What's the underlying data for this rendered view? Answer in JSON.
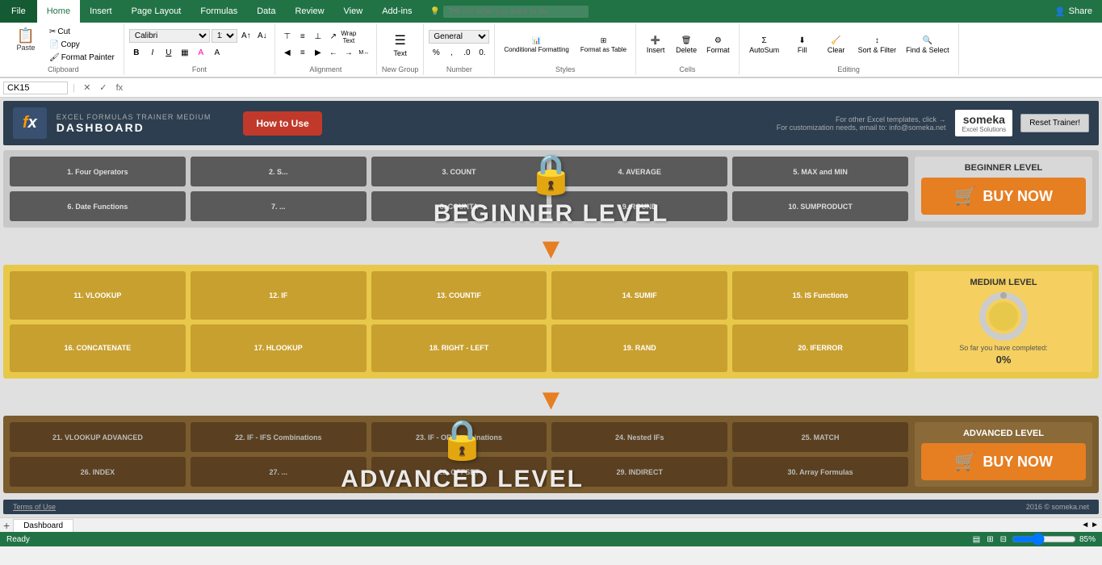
{
  "ribbon": {
    "tabs": [
      "File",
      "Home",
      "Insert",
      "Page Layout",
      "Formulas",
      "Data",
      "Review",
      "View",
      "Add-ins"
    ],
    "active_tab": "Home",
    "tell_me": "Tell me what you want to do",
    "share": "Share",
    "clipboard_group": "Clipboard",
    "paste_label": "Paste",
    "cut_label": "Cut",
    "copy_label": "Copy",
    "format_painter_label": "Format Painter",
    "font_group": "Font",
    "font_name": "Calibri",
    "font_size": "11",
    "alignment_group": "Alignment",
    "wrap_text": "Wrap Text",
    "merge_center": "Merge & Center",
    "number_group": "Number",
    "styles_group": "Styles",
    "conditional_formatting": "Conditional Formatting",
    "format_as_table": "Format as Table",
    "cells_group": "Cells",
    "insert_label": "Insert",
    "delete_label": "Delete",
    "format_label": "Format",
    "editing_group": "Editing",
    "autosum_label": "AutoSum",
    "fill_label": "Fill",
    "clear_label": "Clear",
    "sort_filter_label": "Sort & Filter",
    "find_select_label": "Find & Select",
    "new_group": "New Group",
    "text_label": "Text"
  },
  "formula_bar": {
    "name_box": "CK15",
    "formula_value": ""
  },
  "dashboard": {
    "header": {
      "subtitle": "EXCEL FORMULAS TRAINER MEDIUM",
      "title": "DASHBOARD",
      "how_to_use": "How to Use",
      "contact_line1": "For other Excel templates, click →",
      "contact_line2": "For customization needs, email to: info@someka.net",
      "brand_name": "someka",
      "brand_tagline": "Excel Solutions",
      "reset_btn": "Reset Trainer!"
    },
    "beginner": {
      "level_label": "BEGINNER LEVEL",
      "buttons": [
        "1. Four Operators",
        "2. S...",
        "3. COUNT",
        "4. AVERAGE",
        "5. MAX and MIN",
        "6. Date Functions",
        "7. ...",
        "8. COUNTA",
        "9. ROUND",
        "10. SUMPRODUCT"
      ],
      "buy_now": "BUY NOW",
      "overlay_text": "BEGINNER LEVEL"
    },
    "medium": {
      "level_label": "MEDIUM LEVEL",
      "progress_text": "So far you have completed:",
      "progress_pct": "0%",
      "buttons": [
        "11. VLOOKUP",
        "12. IF",
        "13. COUNTIF",
        "14. SUMIF",
        "15. IS Functions",
        "16. CONCATENATE",
        "17. HLOOKUP",
        "18. RIGHT - LEFT",
        "19. RAND",
        "20. IFERROR"
      ]
    },
    "advanced": {
      "level_label": "ADVANCED LEVEL",
      "buttons": [
        "21. VLOOKUP ADVANCED",
        "22. IF - IFS Combinations",
        "23. IF - OR Combinations",
        "24. Nested IFs",
        "25. MATCH",
        "26. INDEX",
        "27. ...",
        "28. OFFSET",
        "29. INDIRECT",
        "30. Array Formulas"
      ],
      "buy_now": "BUY NOW",
      "overlay_text": "ADVANCED LEVEL"
    },
    "footer": {
      "terms": "Terms of Use",
      "copyright": "2016 © someka.net"
    }
  },
  "status_bar": {
    "status": "Ready",
    "zoom": "85%"
  }
}
